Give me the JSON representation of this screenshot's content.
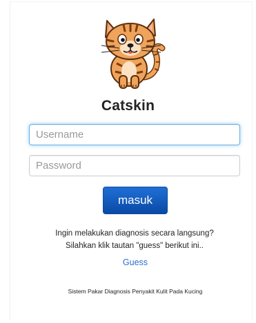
{
  "brand": {
    "title": "Catskin",
    "logo": "cartoon-cat-logo"
  },
  "form": {
    "username_placeholder": "Username",
    "username_value": "",
    "password_placeholder": "Password",
    "password_value": "",
    "submit_label": "masuk"
  },
  "info": {
    "line1": "Ingin melakukan diagnosis secara langsung?",
    "line2": "Silahkan klik tautan \"guess\" berikut ini..",
    "guess_link": "Guess"
  },
  "footer": {
    "text": "Sistem Pakar Diagnosis Penyakit Kulit Pada Kucing"
  },
  "colors": {
    "accent": "#1f6fd6",
    "link": "#2a6fc9",
    "focus_border": "#66afe9",
    "cat_orange": "#f0a35a",
    "cat_stripe": "#7a3f12"
  }
}
